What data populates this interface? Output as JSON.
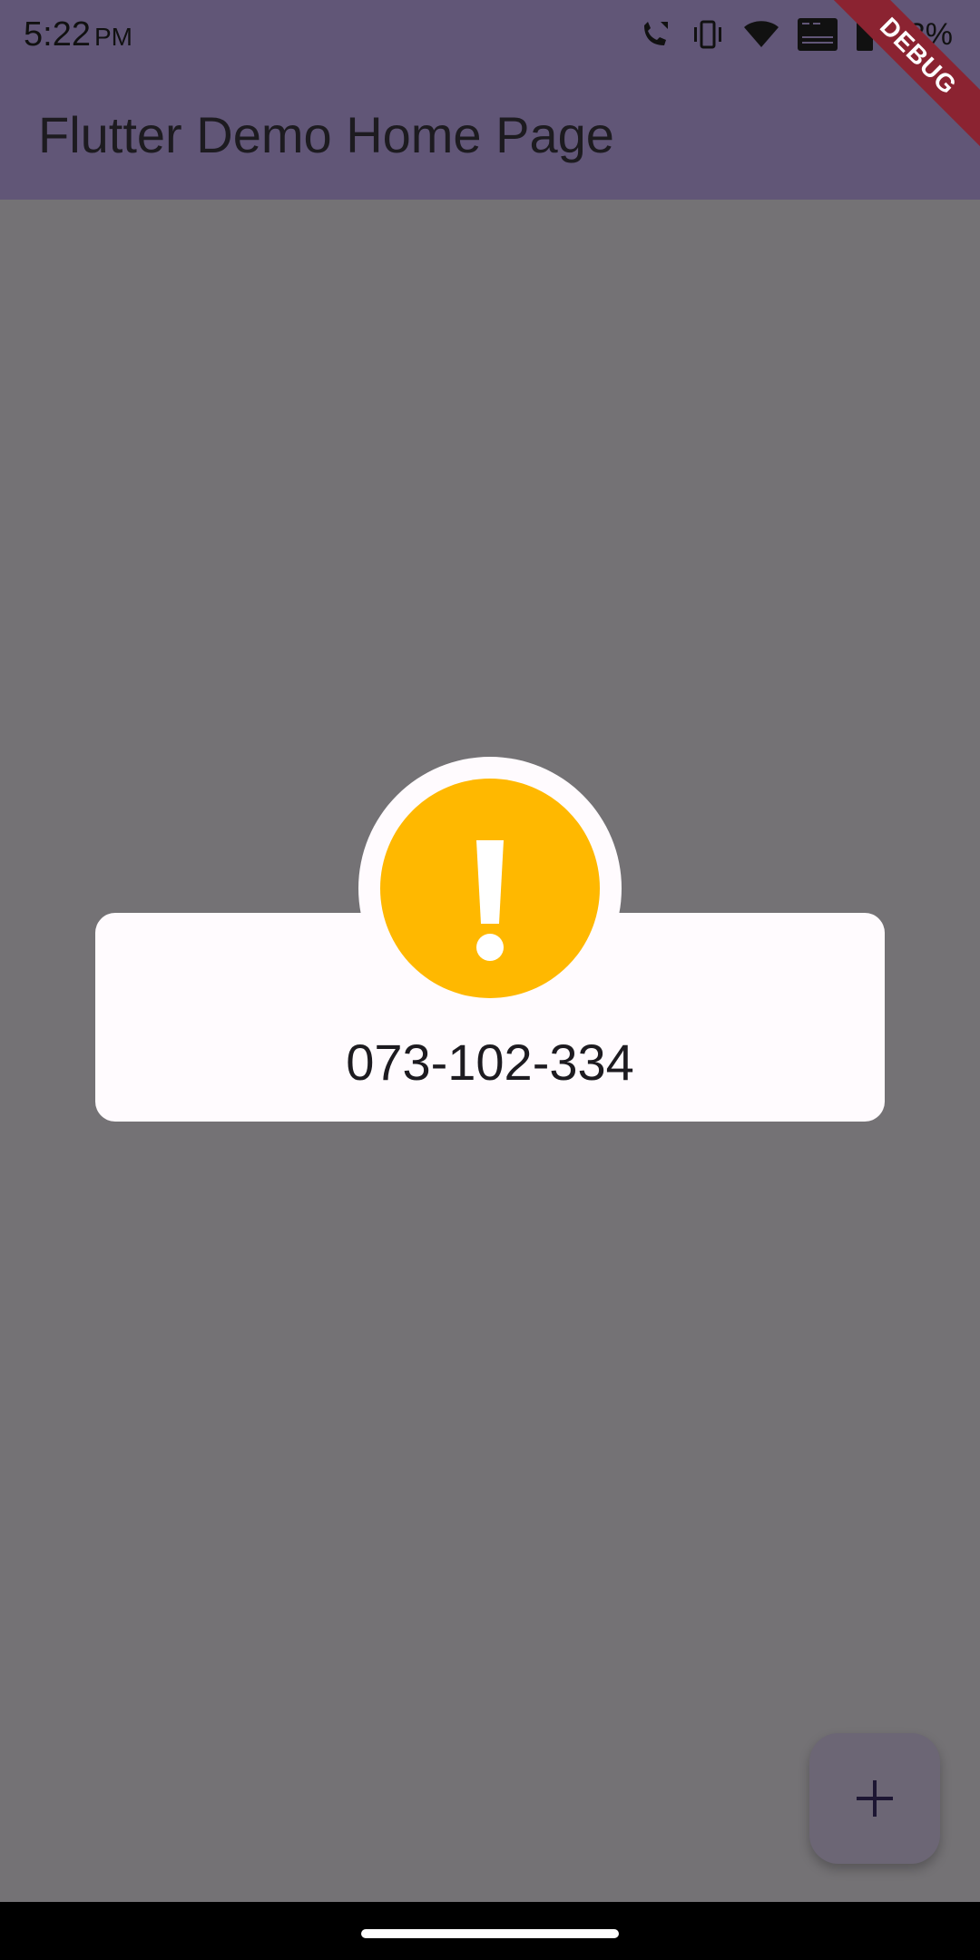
{
  "status_bar": {
    "time": "5:22",
    "ampm": "PM",
    "battery": "43%",
    "icons": [
      "call-icon",
      "vibrate-icon",
      "wifi-icon",
      "vowifi-icon",
      "battery-icon"
    ]
  },
  "debug_banner": {
    "label": "DEBUG",
    "color": "#8b2331"
  },
  "app_bar": {
    "title": "Flutter Demo Home Page",
    "color": "#615677"
  },
  "dialog": {
    "icon": "exclamation-icon",
    "icon_color": "#ffb800",
    "message": "073-102-334"
  },
  "fab": {
    "icon": "plus-icon"
  }
}
